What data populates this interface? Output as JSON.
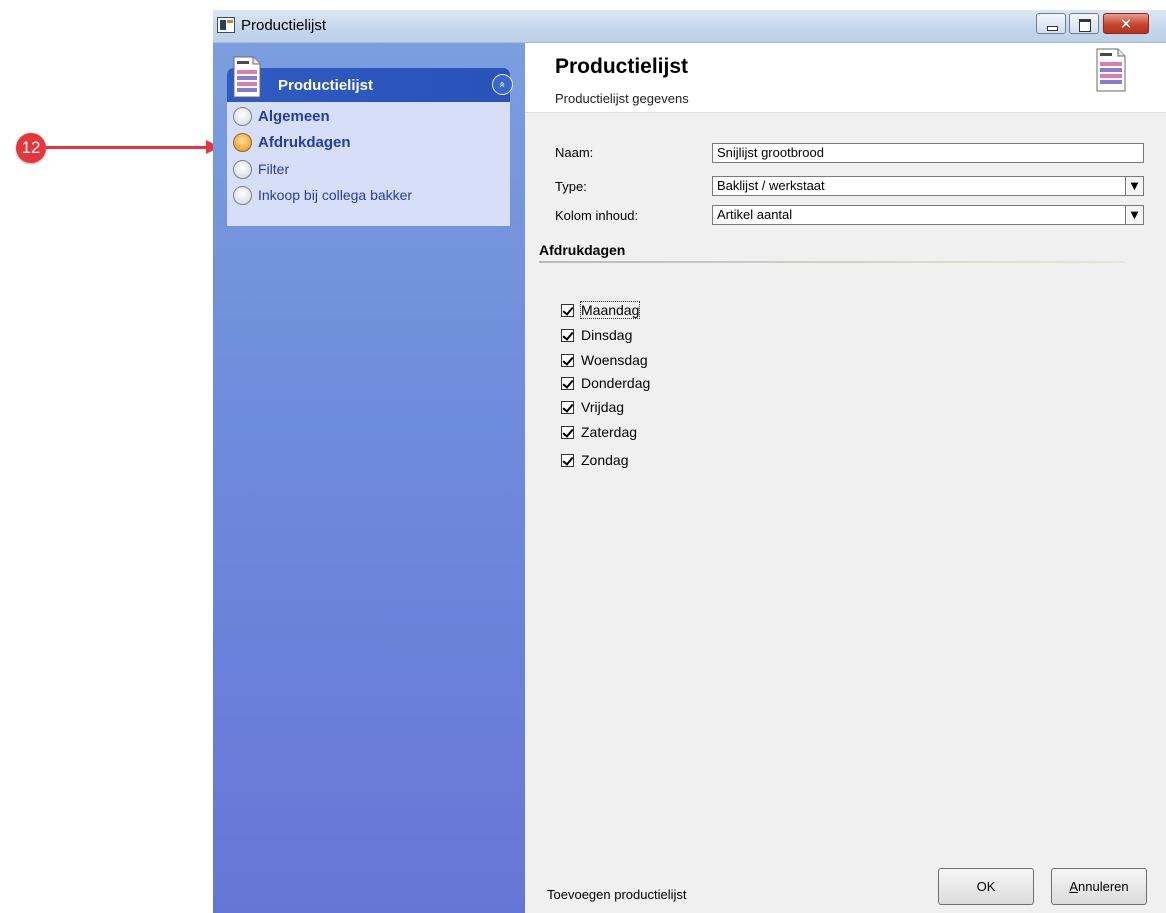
{
  "annotation": {
    "number": "12"
  },
  "window": {
    "title": "Productielijst"
  },
  "sidebar": {
    "panel_title": "Productielijst",
    "collapse_glyph": "«",
    "items": [
      {
        "label": "Algemeen",
        "bold": true,
        "active": false
      },
      {
        "label": "Afdrukdagen",
        "bold": true,
        "active": true
      },
      {
        "label": "Filter",
        "bold": false,
        "active": false
      },
      {
        "label": "Inkoop bij collega bakker",
        "bold": false,
        "active": false
      }
    ]
  },
  "main": {
    "title": "Productielijst",
    "subtitle": "Productielijst gegevens",
    "form": {
      "naam": {
        "label": "Naam:",
        "value": "Snijlijst grootbrood"
      },
      "type": {
        "label": "Type:",
        "value": "Baklijst / werkstaat"
      },
      "kolom": {
        "label": "Kolom inhoud:",
        "value": "Artikel aantal"
      },
      "arrow_glyph": "▼"
    },
    "section_title": "Afdrukdagen",
    "days": [
      {
        "label": "Maandag",
        "checked": true
      },
      {
        "label": "Dinsdag",
        "checked": true
      },
      {
        "label": "Woensdag",
        "checked": true
      },
      {
        "label": "Donderdag",
        "checked": true
      },
      {
        "label": "Vrijdag",
        "checked": true
      },
      {
        "label": "Zaterdag",
        "checked": true
      },
      {
        "label": "Zondag",
        "checked": true
      }
    ]
  },
  "footer": {
    "status_text": "Toevoegen productielijst",
    "ok_label": "OK",
    "cancel_label": "Annuleren"
  },
  "colors": {
    "accent": "#2e5bc2",
    "active_radio": "#f6ac42",
    "annotation": "#e8353a"
  }
}
